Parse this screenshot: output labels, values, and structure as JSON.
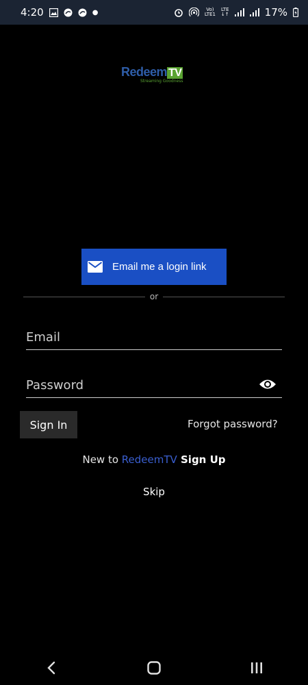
{
  "status_bar": {
    "time": "4:20",
    "network_top": "Vo)",
    "network_bottom": "LTE1",
    "lte_top": "LTE",
    "lte_bottom": "↓↑",
    "battery": "17%"
  },
  "logo": {
    "name_part1": "Redeem",
    "name_part2": "TV",
    "tagline": "Streaming Goodness"
  },
  "email_link_button": {
    "label": "Email me a login link",
    "icon": "mail-icon"
  },
  "divider": {
    "text": "or"
  },
  "form": {
    "email_placeholder": "Email",
    "email_value": "",
    "password_placeholder": "Password",
    "password_value": "",
    "show_password_icon": "eye-icon"
  },
  "actions": {
    "sign_in_label": "Sign In",
    "forgot_password_label": "Forgot password?",
    "signup_prefix": "New to ",
    "signup_brand": "RedeemTV",
    "signup_label": " Sign Up",
    "skip_label": "Skip"
  },
  "colors": {
    "primary_button": "#1a4fc4",
    "brand_blue": "#3a5fd0",
    "brand_green": "#5aa332",
    "background": "#000000"
  },
  "nav_bar": {
    "back_icon": "back-chevron-icon",
    "home_icon": "home-icon",
    "recents_icon": "recents-icon"
  }
}
